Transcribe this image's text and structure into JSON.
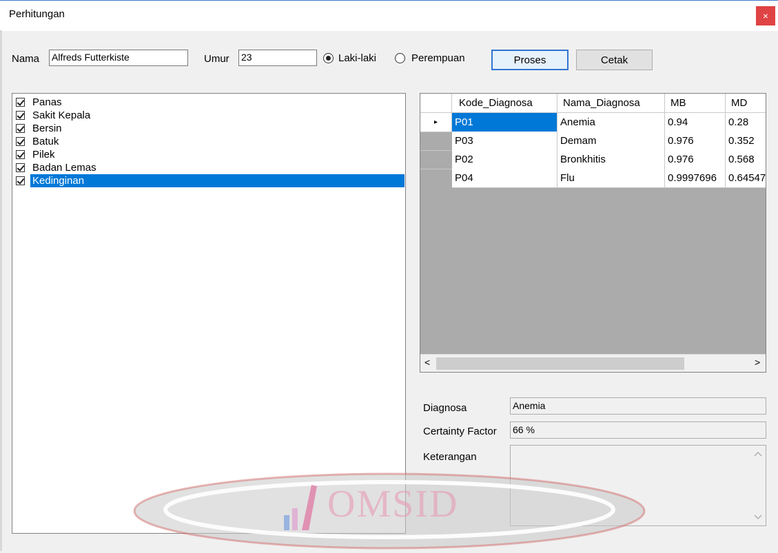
{
  "window": {
    "title": "Perhitungan",
    "close_glyph": "×"
  },
  "form": {
    "nama_label": "Nama",
    "nama_value": "Alfreds Futterkiste",
    "umur_label": "Umur",
    "umur_value": "23",
    "gender_male": "Laki-laki",
    "gender_female": "Perempuan",
    "gender_selected": "Laki-laki",
    "proses_label": "Proses",
    "cetak_label": "Cetak"
  },
  "symptoms": [
    {
      "label": "Panas",
      "checked": true
    },
    {
      "label": "Sakit Kepala",
      "checked": true
    },
    {
      "label": "Bersin",
      "checked": true
    },
    {
      "label": "Batuk",
      "checked": true
    },
    {
      "label": "Pilek",
      "checked": true
    },
    {
      "label": "Badan Lemas",
      "checked": true
    },
    {
      "label": "Kedinginan",
      "checked": true,
      "selected": true
    }
  ],
  "grid": {
    "columns": [
      "Kode_Diagnosa",
      "Nama_Diagnosa",
      "MB",
      "MD"
    ],
    "rows": [
      [
        "P01",
        "Anemia",
        "0.94",
        "0.28"
      ],
      [
        "P03",
        "Demam",
        "0.976",
        "0.352"
      ],
      [
        "P02",
        "Bronkhitis",
        "0.976",
        "0.568"
      ],
      [
        "P04",
        "Flu",
        "0.9997696",
        "0.64547"
      ]
    ],
    "current_row_glyph": "▸",
    "scroll_left_glyph": "<",
    "scroll_right_glyph": ">"
  },
  "result": {
    "diagnosa_label": "Diagnosa",
    "diagnosa_value": "Anemia",
    "cf_label": "Certainty Factor",
    "cf_value": "66 %",
    "keterangan_label": "Keterangan",
    "keterangan_value": ""
  },
  "watermark": {
    "text": "OMSID"
  },
  "colors": {
    "selection": "#0078d7",
    "close": "#e04343",
    "grid_bg": "#ababab"
  }
}
